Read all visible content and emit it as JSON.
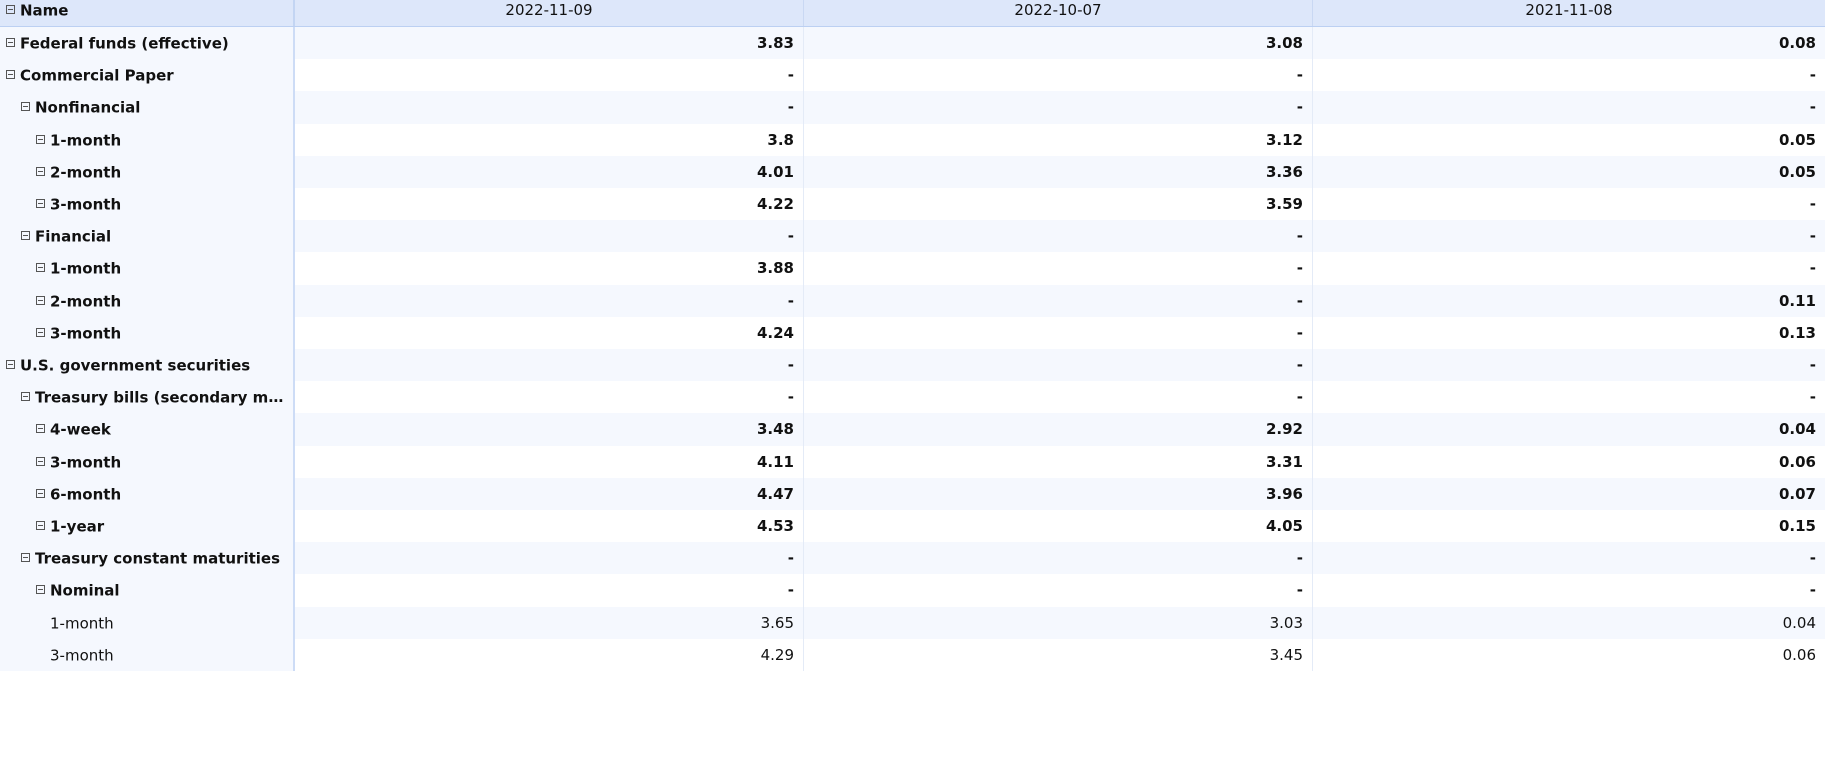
{
  "header": {
    "name_label": "Name",
    "dates": [
      "2022-11-09",
      "2022-10-07",
      "2021-11-08"
    ]
  },
  "rows": [
    {
      "label": "Federal funds (effective)",
      "level": 0,
      "toggle": true,
      "bold": true,
      "values": [
        "3.83",
        "3.08",
        "0.08"
      ]
    },
    {
      "label": "Commercial Paper",
      "level": 0,
      "toggle": true,
      "bold": true,
      "values": [
        "-",
        "-",
        "-"
      ]
    },
    {
      "label": "Nonfinancial",
      "level": 1,
      "toggle": true,
      "bold": true,
      "values": [
        "-",
        "-",
        "-"
      ]
    },
    {
      "label": "1-month",
      "level": 2,
      "toggle": true,
      "bold": true,
      "values": [
        "3.8",
        "3.12",
        "0.05"
      ]
    },
    {
      "label": "2-month",
      "level": 2,
      "toggle": true,
      "bold": true,
      "values": [
        "4.01",
        "3.36",
        "0.05"
      ]
    },
    {
      "label": "3-month",
      "level": 2,
      "toggle": true,
      "bold": true,
      "values": [
        "4.22",
        "3.59",
        "-"
      ]
    },
    {
      "label": "Financial",
      "level": 1,
      "toggle": true,
      "bold": true,
      "values": [
        "-",
        "-",
        "-"
      ]
    },
    {
      "label": "1-month",
      "level": 2,
      "toggle": true,
      "bold": true,
      "values": [
        "3.88",
        "-",
        "-"
      ]
    },
    {
      "label": "2-month",
      "level": 2,
      "toggle": true,
      "bold": true,
      "values": [
        "-",
        "-",
        "0.11"
      ]
    },
    {
      "label": "3-month",
      "level": 2,
      "toggle": true,
      "bold": true,
      "values": [
        "4.24",
        "-",
        "0.13"
      ]
    },
    {
      "label": "U.S. government securities",
      "level": 0,
      "toggle": true,
      "bold": true,
      "values": [
        "-",
        "-",
        "-"
      ]
    },
    {
      "label": "Treasury bills (secondary mark...",
      "level": 1,
      "toggle": true,
      "bold": true,
      "values": [
        "-",
        "-",
        "-"
      ]
    },
    {
      "label": "4-week",
      "level": 2,
      "toggle": true,
      "bold": true,
      "values": [
        "3.48",
        "2.92",
        "0.04"
      ]
    },
    {
      "label": "3-month",
      "level": 2,
      "toggle": true,
      "bold": true,
      "hover": true,
      "values": [
        "4.11",
        "3.31",
        "0.06"
      ]
    },
    {
      "label": "6-month",
      "level": 2,
      "toggle": true,
      "bold": true,
      "values": [
        "4.47",
        "3.96",
        "0.07"
      ]
    },
    {
      "label": "1-year",
      "level": 2,
      "toggle": true,
      "bold": true,
      "values": [
        "4.53",
        "4.05",
        "0.15"
      ]
    },
    {
      "label": "Treasury constant maturities",
      "level": 1,
      "toggle": true,
      "bold": true,
      "values": [
        "-",
        "-",
        "-"
      ]
    },
    {
      "label": "Nominal",
      "level": 2,
      "toggle": true,
      "bold": true,
      "values": [
        "-",
        "-",
        "-"
      ]
    },
    {
      "label": "1-month",
      "level": 3,
      "toggle": false,
      "bold": false,
      "values": [
        "3.65",
        "3.03",
        "0.04"
      ]
    },
    {
      "label": "3-month",
      "level": 3,
      "toggle": false,
      "bold": false,
      "values": [
        "4.29",
        "3.45",
        "0.06"
      ]
    }
  ]
}
